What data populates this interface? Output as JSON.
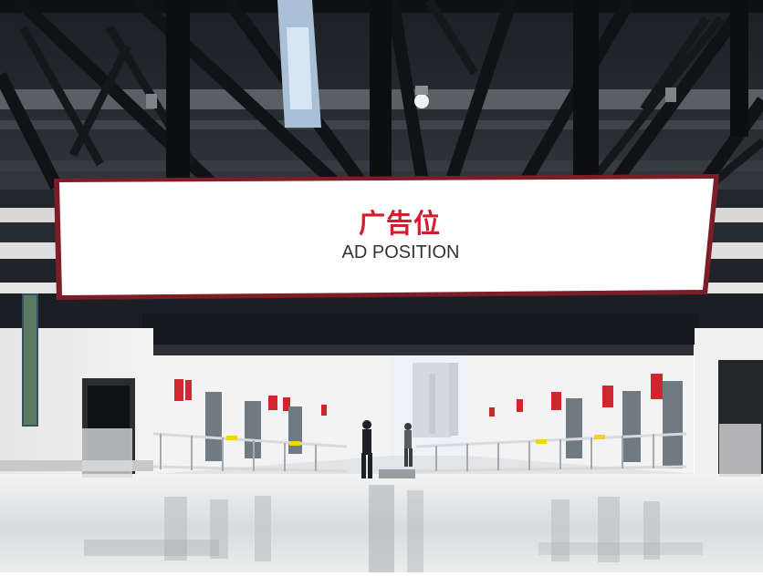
{
  "photo": {
    "billboard": {
      "title_cn": "广告位",
      "title_en": "AD POSITION"
    },
    "colors": {
      "frame": "#7d1d28",
      "title_red": "#d11d2d",
      "subtitle_gray": "#333333",
      "ceiling_dark": "#111417",
      "floor_light": "#e8e8e8"
    }
  }
}
